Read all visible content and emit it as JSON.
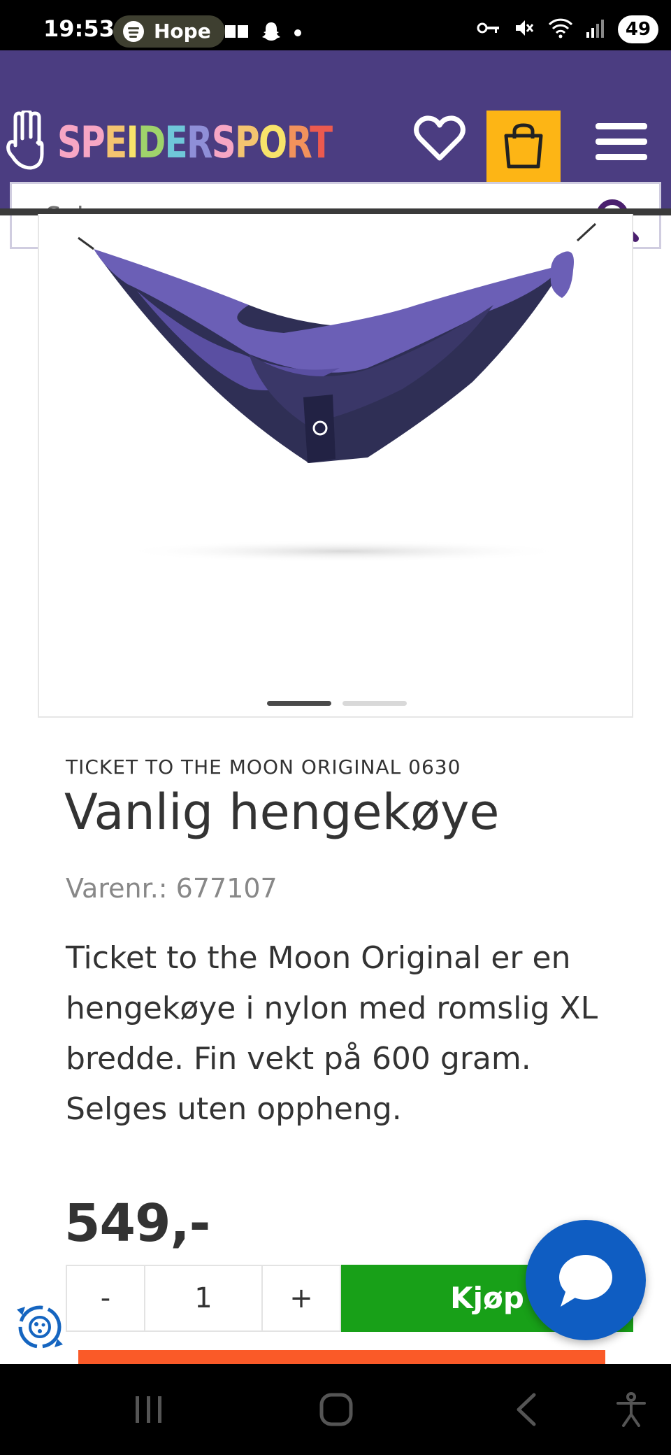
{
  "status_bar": {
    "time": "19:53",
    "media_label": "Hope",
    "battery": "49"
  },
  "header": {
    "brand_name": "SPEIDERSPORT",
    "brand_letter_colors": [
      "#f7a6c4",
      "#f7a6c4",
      "#f4c470",
      "#f8e36a",
      "#9fd36b",
      "#6fc7d9",
      "#8f8fd8",
      "#f7a6c4",
      "#f4c470",
      "#f8e36a",
      "#f2925c",
      "#ec5a4f"
    ],
    "accent_color": "#4b3d81",
    "cart_color": "#fdb515"
  },
  "search": {
    "placeholder": "Søk"
  },
  "gallery": {
    "slides": 2,
    "active_slide": 1
  },
  "product": {
    "brand_line": "TICKET TO THE MOON ORIGINAL 0630",
    "title": "Vanlig hengekøye",
    "sku": "Varenr.: 677107",
    "description": "Ticket to the Moon Original er en hengekøye i nylon med romslig XL bredde. Fin vekt på 600 gram. Selges uten oppheng.",
    "price": "549,-"
  },
  "buy_row": {
    "minus_label": "-",
    "quantity": "1",
    "plus_label": "+",
    "buy_label": "Kjøp",
    "buy_color": "#18a018"
  }
}
